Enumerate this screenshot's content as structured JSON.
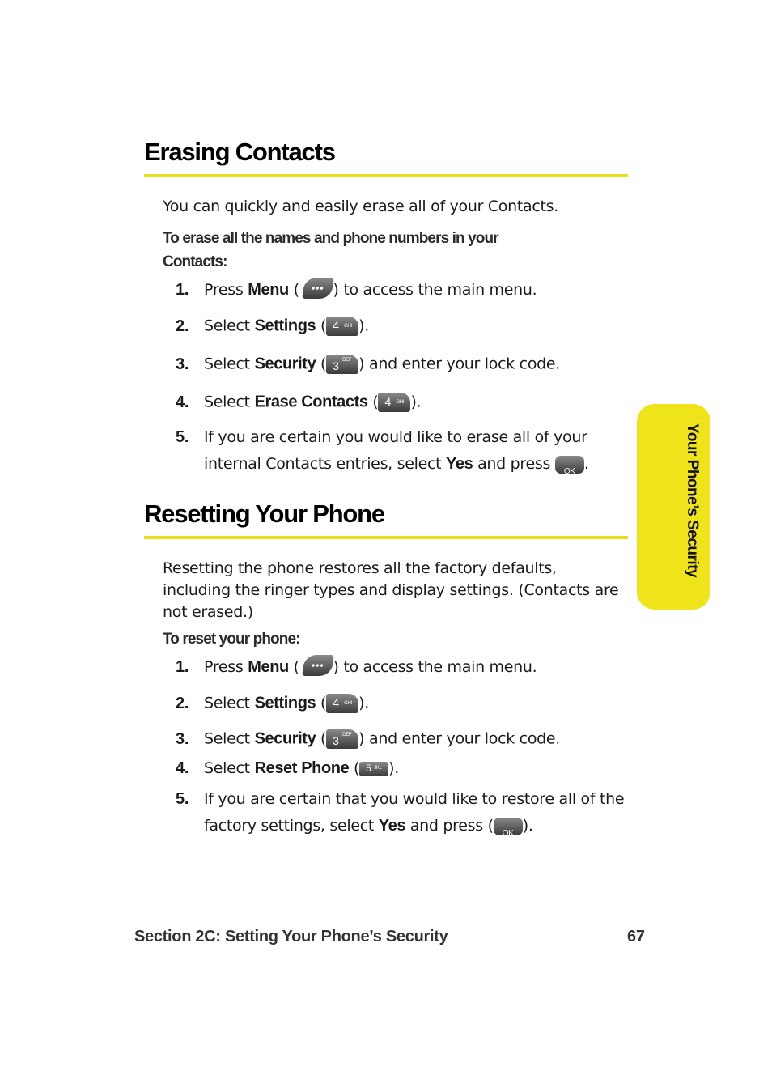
{
  "section1": {
    "title": "Erasing Contacts",
    "intro": "You can quickly and easily erase all of your Contacts.",
    "subheading_line1": "To erase all the names and phone numbers in your",
    "subheading_line2": "Contacts:",
    "steps": [
      {
        "num": "1.",
        "pre": "Press ",
        "bold": "Menu",
        "open": " (",
        "key": "menu-key",
        "post": ") to access the main menu."
      },
      {
        "num": "2.",
        "pre": "Select ",
        "bold": "Settings",
        "open": " (",
        "key_digit": "4",
        "key_letters": "GHI",
        "post": ")."
      },
      {
        "num": "3.",
        "pre": "Select ",
        "bold": "Security",
        "open": " (",
        "key_digit": "3",
        "key_letters": "DEF",
        "post": ") and enter your lock code."
      },
      {
        "num": "4.",
        "pre": "Select ",
        "bold": "Erase Contacts",
        "open": " (",
        "key_digit": "4",
        "key_letters": "GHI",
        "post": ")."
      },
      {
        "num": "5.",
        "line1": "If you are certain you would like to erase all of your",
        "pre": "internal Contacts entries, select ",
        "bold": "Yes",
        "mid": " and press ",
        "key_label": "OK",
        "post": "."
      }
    ]
  },
  "section2": {
    "title": "Resetting Your Phone",
    "intro_lines": [
      "Resetting the phone restores all the factory defaults,",
      "including the ringer types and display settings. (Contacts are",
      "not erased.)"
    ],
    "subheading": "To reset your phone:",
    "steps": [
      {
        "num": "1.",
        "pre": "Press ",
        "bold": "Menu",
        "open": " (",
        "post": ") to access the main menu."
      },
      {
        "num": "2.",
        "pre": "Select ",
        "bold": "Settings",
        "open": " (",
        "key_digit": "4",
        "key_letters": "GHI",
        "post": ")."
      },
      {
        "num": "3.",
        "pre": "Select ",
        "bold": "Security",
        "open": " (",
        "key_digit": "3",
        "key_letters": "DEF",
        "post": ") and enter your lock code."
      },
      {
        "num": "4.",
        "pre": "Select ",
        "bold": "Reset Phone",
        "open": " (",
        "key_digit": "5",
        "key_letters": "JKL",
        "post": ")."
      },
      {
        "num": "5.",
        "line1": "If you are certain that you would like to restore all of the",
        "pre": "factory settings, select ",
        "bold": "Yes",
        "mid": " and press (",
        "key_label": "OK",
        "post": ")."
      }
    ]
  },
  "side_tab": {
    "label": "Your Phone’s Security",
    "color": "#efe41a"
  },
  "footer": {
    "section": "Section 2C: Setting Your Phone’s Security",
    "page": "67"
  },
  "colors": {
    "accent_rule": "#eadf1c"
  }
}
